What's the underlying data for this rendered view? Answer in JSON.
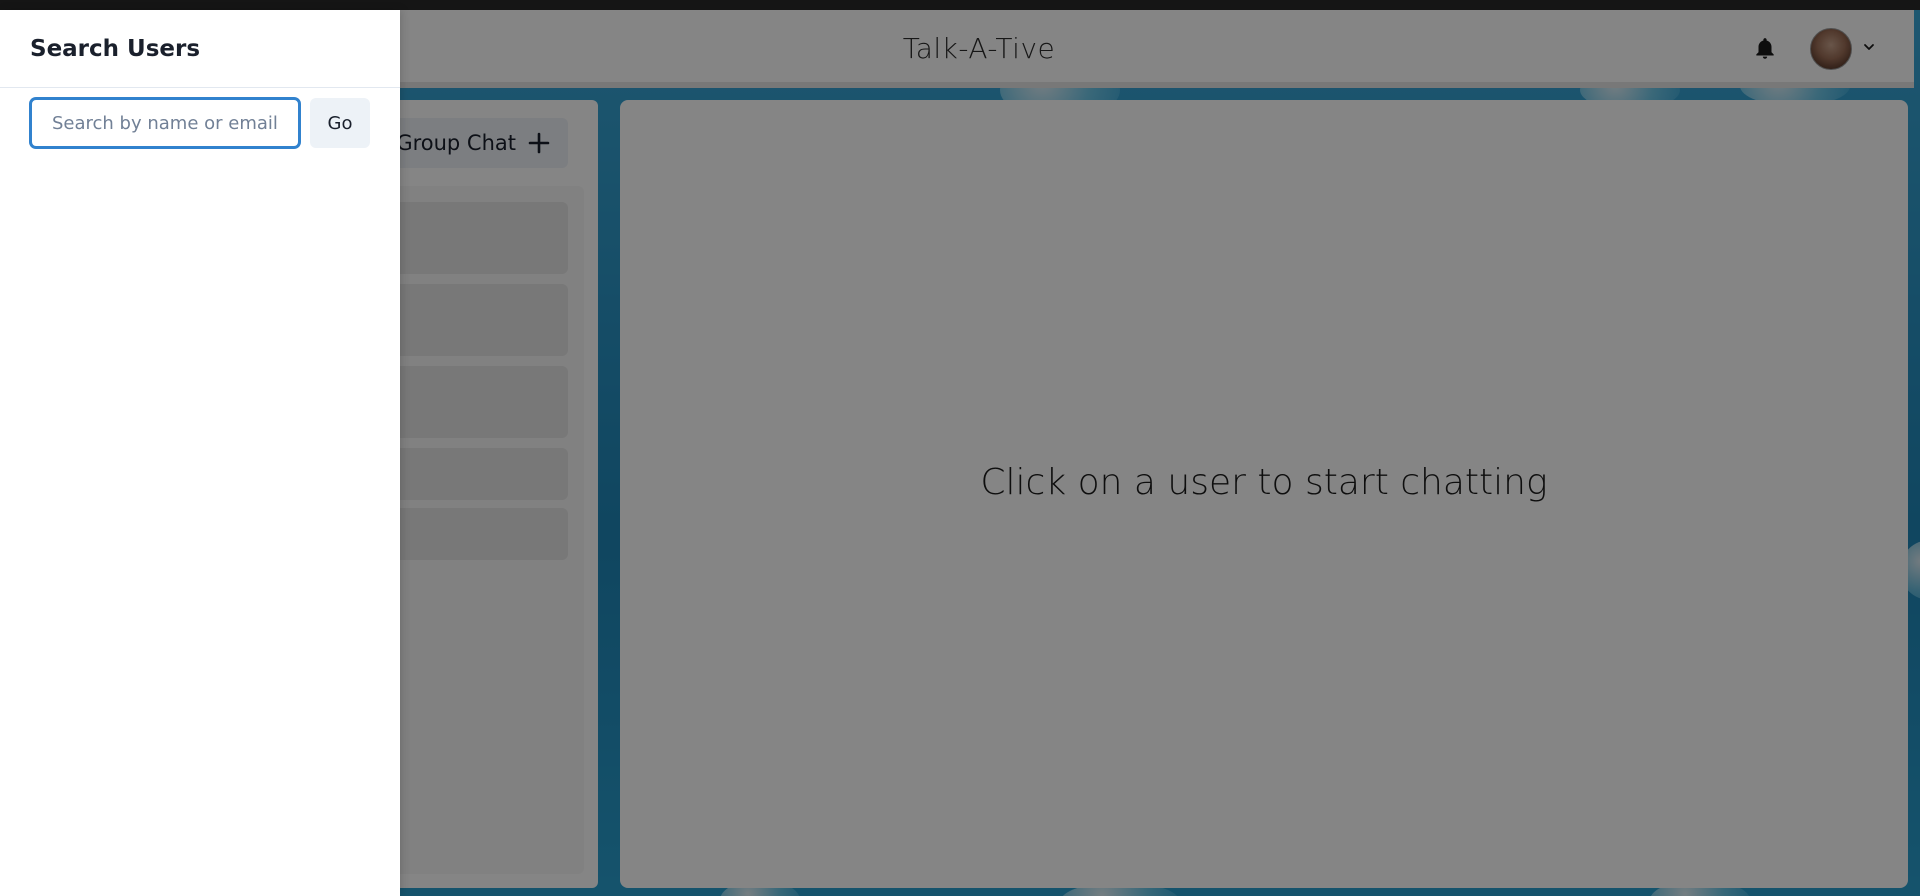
{
  "header": {
    "title": "Talk-A-Tive",
    "notification_icon": "bell-icon",
    "profile_icon": "avatar",
    "profile_menu_icon": "chevron-down-icon"
  },
  "sidebar": {
    "new_group_chat_label": "Group Chat",
    "new_group_chat_icon": "plus-icon",
    "chat_items": [
      "",
      "",
      "",
      "",
      ""
    ]
  },
  "main": {
    "empty_message": "Click on a user to start chatting"
  },
  "drawer": {
    "title": "Search Users",
    "search_placeholder": "Search by name or email",
    "search_value": "",
    "go_label": "Go"
  },
  "colors": {
    "accent": "#3182ce",
    "background_blue": "#1f86b8",
    "overlay": "rgba(0,0,0,0.48)"
  }
}
